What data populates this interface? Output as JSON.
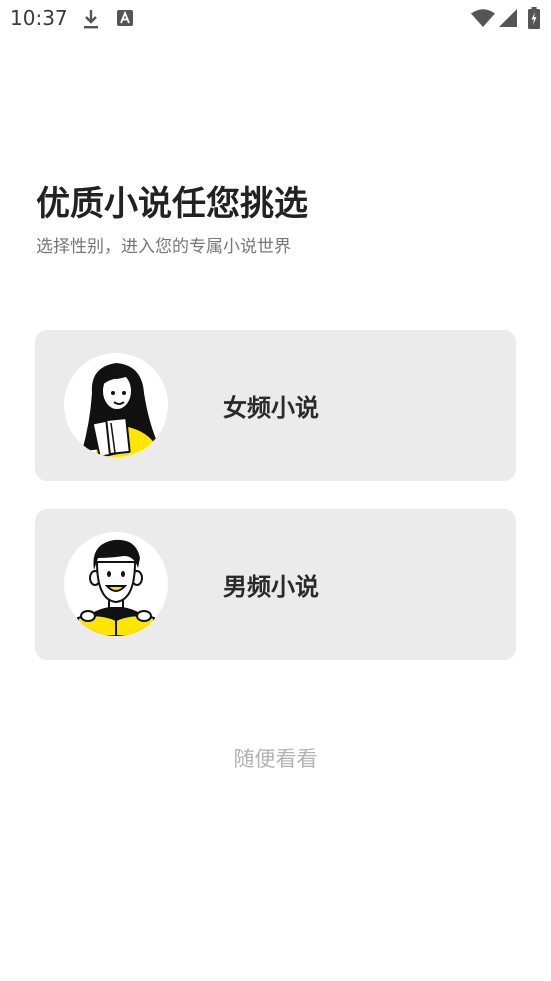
{
  "status_bar": {
    "time": "10:37",
    "icons": [
      "download-icon",
      "a-notification-icon",
      "wifi-icon",
      "cell-signal-icon",
      "battery-charging-icon"
    ]
  },
  "header": {
    "title": "优质小说任您挑选",
    "subtitle": "选择性别，进入您的专属小说世界"
  },
  "options": [
    {
      "label": "女频小说",
      "avatar": "girl-avatar-icon"
    },
    {
      "label": "男频小说",
      "avatar": "boy-avatar-icon"
    }
  ],
  "skip": {
    "label": "随便看看"
  },
  "colors": {
    "card_background": "#ebebeb",
    "accent_yellow": "#ffe600",
    "title_text": "#222222",
    "subtitle_text": "#777777",
    "skip_text": "#b3b3b3"
  }
}
